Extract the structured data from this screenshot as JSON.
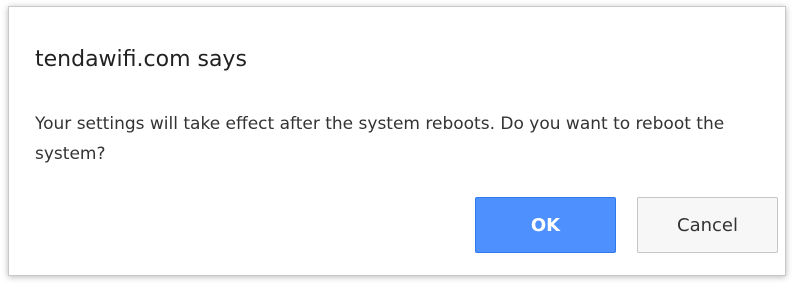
{
  "dialog": {
    "title": "tendawifi.com says",
    "message": "Your settings will take effect after the system reboots. Do you want to reboot the system?",
    "ok_label": "OK",
    "cancel_label": "Cancel"
  },
  "colors": {
    "ok_button_bg": "#4d90fe",
    "ok_button_border": "#3079ed",
    "cancel_button_bg": "#f7f7f7",
    "dialog_border": "#c9c9c9"
  }
}
